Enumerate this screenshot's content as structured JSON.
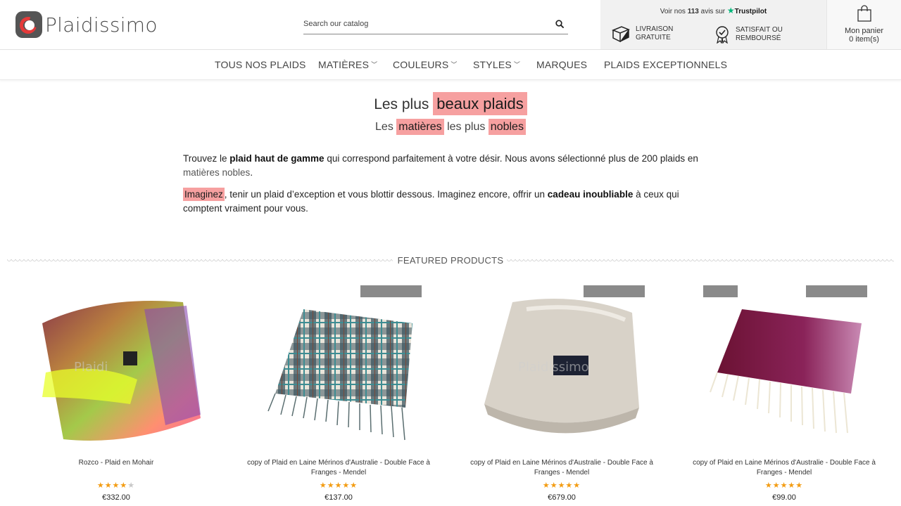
{
  "brand": {
    "name": "Plaidissimo"
  },
  "search": {
    "placeholder": "Search our catalog"
  },
  "reassurance": {
    "trustpilot_prefix": "Voir nos",
    "trustpilot_count": "113",
    "trustpilot_suffix": "avis sur",
    "trustpilot_brand": "Trustpilot",
    "delivery_line1": "LIVRAISON",
    "delivery_line2": "GRATUITE",
    "refund_line1": "SATISFAIT OU",
    "refund_line2": "REMBOURSÉ"
  },
  "cart": {
    "label": "Mon panier",
    "count": "0 item(s)"
  },
  "nav": {
    "items": [
      {
        "label": "TOUS NOS PLAIDS"
      },
      {
        "label": "MATIÈRES"
      },
      {
        "label": "COULEURS"
      },
      {
        "label": "STYLES"
      },
      {
        "label": "MARQUES"
      },
      {
        "label": "PLAIDS EXCEPTIONNELS"
      }
    ]
  },
  "hero": {
    "title_plain": "Les plus",
    "title_highlight": "beaux plaids",
    "sub_1": "Les",
    "sub_hl_1": "matières",
    "sub_2": "les plus",
    "sub_hl_2": "nobles"
  },
  "intro": {
    "p1_a": "Trouvez le ",
    "p1_bold": "plaid haut de gamme",
    "p1_b": " qui correspond parfaitement à votre désir. Nous avons sélectionné plus de 200 plaids en ",
    "p1_link": "matières nobles",
    "p1_c": ".",
    "p2_hl": "Imaginez",
    "p2_a": ", tenir un plaid d’exception et vous blottir dessous. Imaginez encore, offrir un ",
    "p2_bold": "cadeau inoubliable",
    "p2_b": " à ceux qui comptent vraiment pour vous."
  },
  "featured": {
    "title": "FEATURED PRODUCTS",
    "products": [
      {
        "name": "Rozco - Plaid en Mohair",
        "rating": 4,
        "price": "€332.00",
        "watermark": "Plaidi"
      },
      {
        "name": "copy of Plaid en Laine Mérinos d'Australie - Double Face à Franges - Mendel",
        "rating": 5,
        "price": "€137.00",
        "watermark": ""
      },
      {
        "name": "copy of Plaid en Laine Mérinos d'Australie - Double Face à Franges - Mendel",
        "rating": 5,
        "price": "€679.00",
        "watermark": "Plaidissimo"
      },
      {
        "name": "copy of Plaid en Laine Mérinos d'Australie - Double Face à Franges - Mendel",
        "rating": 5,
        "price": "€99.00",
        "watermark": ""
      }
    ]
  },
  "colors": {
    "highlight": "#f6a0a0",
    "star": "#f39c12",
    "trustpilot_green": "#00b67a",
    "logo_red": "#e53a3a",
    "badge_gray": "#8a8a8a"
  },
  "icons": [
    "search-icon",
    "trustpilot-star-icon",
    "delivery-box-icon",
    "refund-badge-icon",
    "shopping-bag-icon",
    "chevron-down-icon"
  ]
}
